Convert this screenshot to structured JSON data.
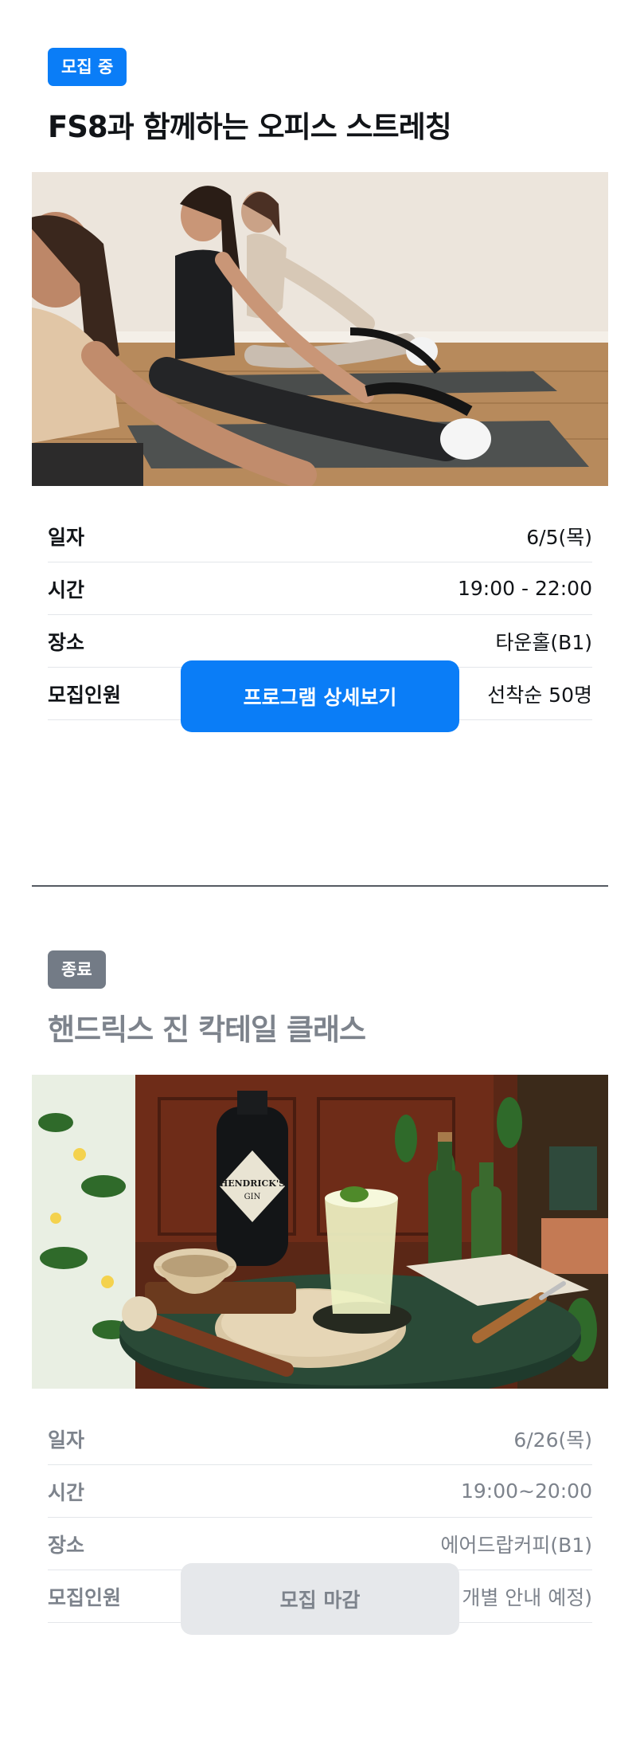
{
  "programs": [
    {
      "status_badge": "모집 중",
      "title": "FS8과 함께하는 오피스 스트레칭",
      "image": {
        "subject": "yoga-stretching-photo"
      },
      "details": [
        {
          "label": "일자",
          "value": "6/5(목)"
        },
        {
          "label": "시간",
          "value": "19:00 - 22:00"
        },
        {
          "label": "장소",
          "value": "타운홀(B1)"
        },
        {
          "label": "모집인원",
          "value": "선착순 50명"
        }
      ],
      "button_label": "프로그램 상세보기",
      "accent_color": "#0a7df7"
    },
    {
      "status_badge": "종료",
      "title": "핸드릭스 진 칵테일 클래스",
      "image": {
        "subject": "gin-cocktail-photo",
        "label_line1": "HENDRICK'S",
        "label_line2": "GIN"
      },
      "details": [
        {
          "label": "일자",
          "value": "6/26(목)"
        },
        {
          "label": "시간",
          "value": "19:00~20:00"
        },
        {
          "label": "장소",
          "value": "에어드랍커피(B1)"
        },
        {
          "label": "모집인원",
          "value": "16명 (추후 개별 안내 예정)"
        }
      ],
      "button_label": "모집 마감",
      "accent_color": "#737b86"
    }
  ]
}
